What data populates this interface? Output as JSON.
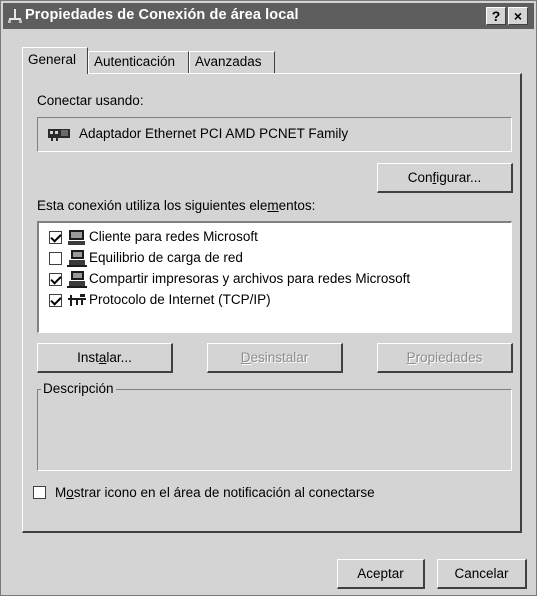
{
  "window": {
    "title": "Propiedades de Conexión de área local",
    "help_button": "?",
    "close_button": "×"
  },
  "tabs": [
    {
      "label": "General",
      "active": true
    },
    {
      "label": "Autenticación",
      "active": false
    },
    {
      "label": "Avanzadas",
      "active": false
    }
  ],
  "connect_using": {
    "label": "Conectar usando:",
    "adapter": "Adaptador Ethernet PCI AMD PCNET Family",
    "adapter_icon": "network-card-icon",
    "configure_button": {
      "pre": "Con",
      "acc": "f",
      "post": "igurar..."
    }
  },
  "elements": {
    "label": {
      "pre": "Esta conexión utiliza los siguientes ele",
      "acc": "m",
      "post": "entos:"
    },
    "items": [
      {
        "label": "Cliente para redes Microsoft",
        "checked": true,
        "icon": "computer-monitor-icon"
      },
      {
        "label": "Equilibrio de carga de red",
        "checked": false,
        "icon": "computer-network-icon"
      },
      {
        "label": "Compartir impresoras y archivos para redes Microsoft",
        "checked": true,
        "icon": "computer-network-icon"
      },
      {
        "label": "Protocolo de Internet (TCP/IP)",
        "checked": true,
        "icon": "protocol-icon"
      }
    ]
  },
  "buttons": {
    "install": {
      "pre": "Inst",
      "acc": "a",
      "post": "lar..."
    },
    "uninstall": {
      "pre": "",
      "acc": "D",
      "post": "esinstalar",
      "enabled": false
    },
    "properties": {
      "pre": "",
      "acc": "P",
      "post": "ropiedades",
      "enabled": false
    }
  },
  "description": {
    "title": "Descripción",
    "text": ""
  },
  "notification": {
    "checked": false,
    "pre": "M",
    "acc": "o",
    "post": "strar icono en el área de notificación al conectarse"
  },
  "footer": {
    "ok": "Aceptar",
    "cancel": "Cancelar"
  }
}
